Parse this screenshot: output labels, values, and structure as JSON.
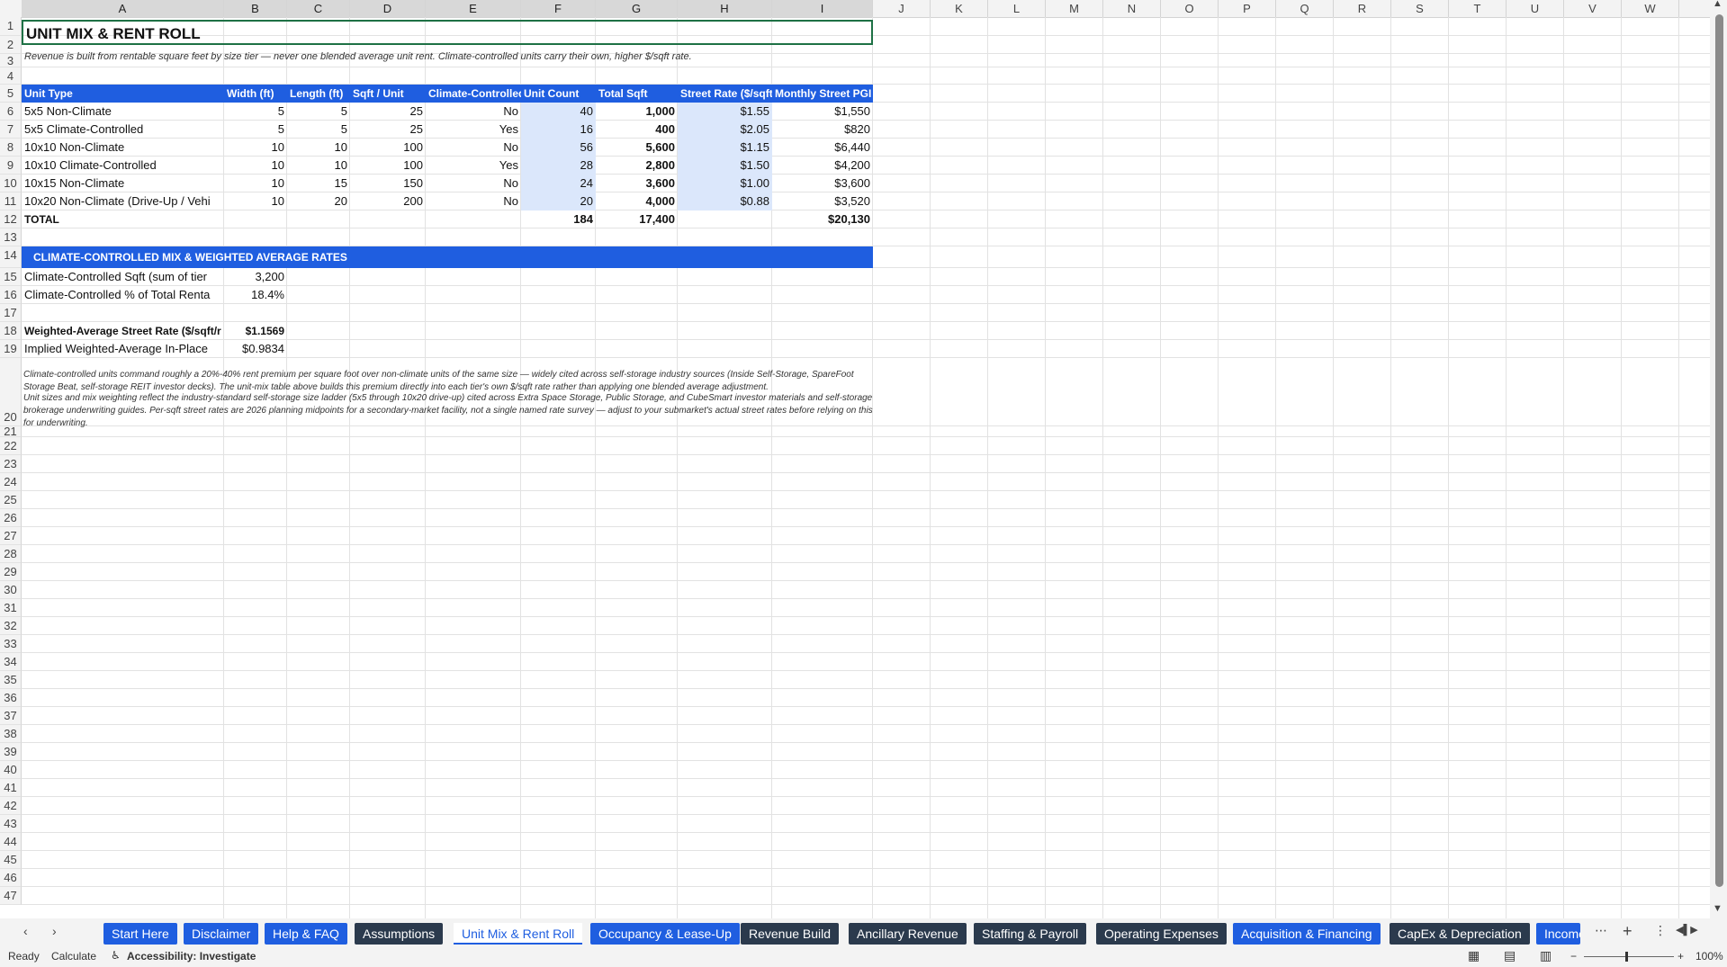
{
  "columns": [
    "A",
    "B",
    "C",
    "D",
    "E",
    "F",
    "G",
    "H",
    "I",
    "J",
    "K",
    "L",
    "M",
    "N",
    "O",
    "P",
    "Q",
    "R",
    "S",
    "T",
    "U",
    "V",
    "W"
  ],
  "rows": [
    "1",
    "2",
    "3",
    "4",
    "5",
    "6",
    "7",
    "8",
    "9",
    "10",
    "11",
    "12",
    "13",
    "14",
    "15",
    "16",
    "17",
    "18",
    "19",
    "20",
    "21",
    "22",
    "23",
    "24",
    "25",
    "26",
    "27",
    "28",
    "29",
    "30",
    "31",
    "32",
    "33",
    "34",
    "35",
    "36",
    "37",
    "38",
    "39",
    "40",
    "41",
    "42",
    "43",
    "44",
    "45",
    "46",
    "47"
  ],
  "title": "UNIT MIX & RENT ROLL",
  "subtitle": "Revenue is built from rentable square feet by size tier — never one blended average unit rent. Climate-controlled units carry their own, higher $/sqft rate.",
  "table": {
    "headers": [
      "Unit Type",
      "Width (ft)",
      "Length (ft)",
      "Sqft / Unit",
      "Climate-Controlled",
      "Unit Count",
      "Total Sqft",
      "Street Rate ($/sqft",
      "Monthly Street PGI"
    ],
    "rows": [
      [
        "5x5 Non-Climate",
        "5",
        "5",
        "25",
        "No",
        "40",
        "1,000",
        "$1.55",
        "$1,550"
      ],
      [
        "5x5 Climate-Controlled",
        "5",
        "5",
        "25",
        "Yes",
        "16",
        "400",
        "$2.05",
        "$820"
      ],
      [
        "10x10 Non-Climate",
        "10",
        "10",
        "100",
        "No",
        "56",
        "5,600",
        "$1.15",
        "$6,440"
      ],
      [
        "10x10 Climate-Controlled",
        "10",
        "10",
        "100",
        "Yes",
        "28",
        "2,800",
        "$1.50",
        "$4,200"
      ],
      [
        "10x15 Non-Climate",
        "10",
        "15",
        "150",
        "No",
        "24",
        "3,600",
        "$1.00",
        "$3,600"
      ],
      [
        "10x20 Non-Climate (Drive-Up / Vehi",
        "10",
        "20",
        "200",
        "No",
        "20",
        "4,000",
        "$0.88",
        "$3,520"
      ]
    ],
    "total": [
      "TOTAL",
      "",
      "",
      "",
      "",
      "184",
      "17,400",
      "",
      "$20,130"
    ]
  },
  "section2": {
    "header": "CLIMATE-CONTROLLED MIX & WEIGHTED AVERAGE RATES",
    "rows": [
      {
        "label": "Climate-Controlled Sqft (sum of tier",
        "value": "3,200",
        "bold": false
      },
      {
        "label": "Climate-Controlled % of Total Renta",
        "value": "18.4%",
        "bold": false
      },
      {
        "label": "",
        "value": "",
        "bold": false
      },
      {
        "label": "Weighted-Average Street Rate ($/sqft/r",
        "value": "$1.1569",
        "bold": true
      },
      {
        "label": "Implied Weighted-Average In-Place",
        "value": "$0.9834",
        "bold": false
      }
    ]
  },
  "notes": {
    "row19": "Climate-controlled units command roughly a 20%-40% rent premium per square foot over non-climate units of the same size — widely cited across self-storage industry sources (Inside Self-Storage, SpareFoot Storage Beat, self-storage REIT investor decks). The unit-mix table above builds this premium directly into each tier's own $/sqft rate rather than applying one blended average adjustment.",
    "row20": "Unit sizes and mix weighting reflect the industry-standard self-storage size ladder (5x5 through 10x20 drive-up) cited across Extra Space Storage, Public Storage, and CubeSmart investor materials and self-storage brokerage underwriting guides. Per-sqft street rates are 2026 planning midpoints for a secondary-market facility, not a single named rate survey — adjust to your submarket's actual street rates before relying on this for underwriting."
  },
  "tabs": [
    {
      "label": "Start Here",
      "style": "blue"
    },
    {
      "label": "Disclaimer",
      "style": "blue"
    },
    {
      "label": "Help & FAQ",
      "style": "blue"
    },
    {
      "label": "Assumptions",
      "style": "dark"
    },
    {
      "label": "Unit Mix & Rent Roll",
      "style": "active"
    },
    {
      "label": "Occupancy & Lease-Up",
      "style": "blue"
    },
    {
      "label": "Revenue Build",
      "style": "dark"
    },
    {
      "label": "Ancillary Revenue",
      "style": "dark"
    },
    {
      "label": "Staffing & Payroll",
      "style": "dark"
    },
    {
      "label": "Operating Expenses",
      "style": "dark"
    },
    {
      "label": "Acquisition & Financing",
      "style": "blue"
    },
    {
      "label": "CapEx & Depreciation",
      "style": "dark"
    },
    {
      "label": "Income",
      "style": "blue"
    }
  ],
  "status": {
    "ready": "Ready",
    "calculate": "Calculate",
    "accessibility": "Accessibility: Investigate",
    "zoom": "100%"
  },
  "colors": {
    "accent": "#1f5ee0",
    "input_fill": "#dbe7fb",
    "dark_tab": "#2b3a4d"
  }
}
